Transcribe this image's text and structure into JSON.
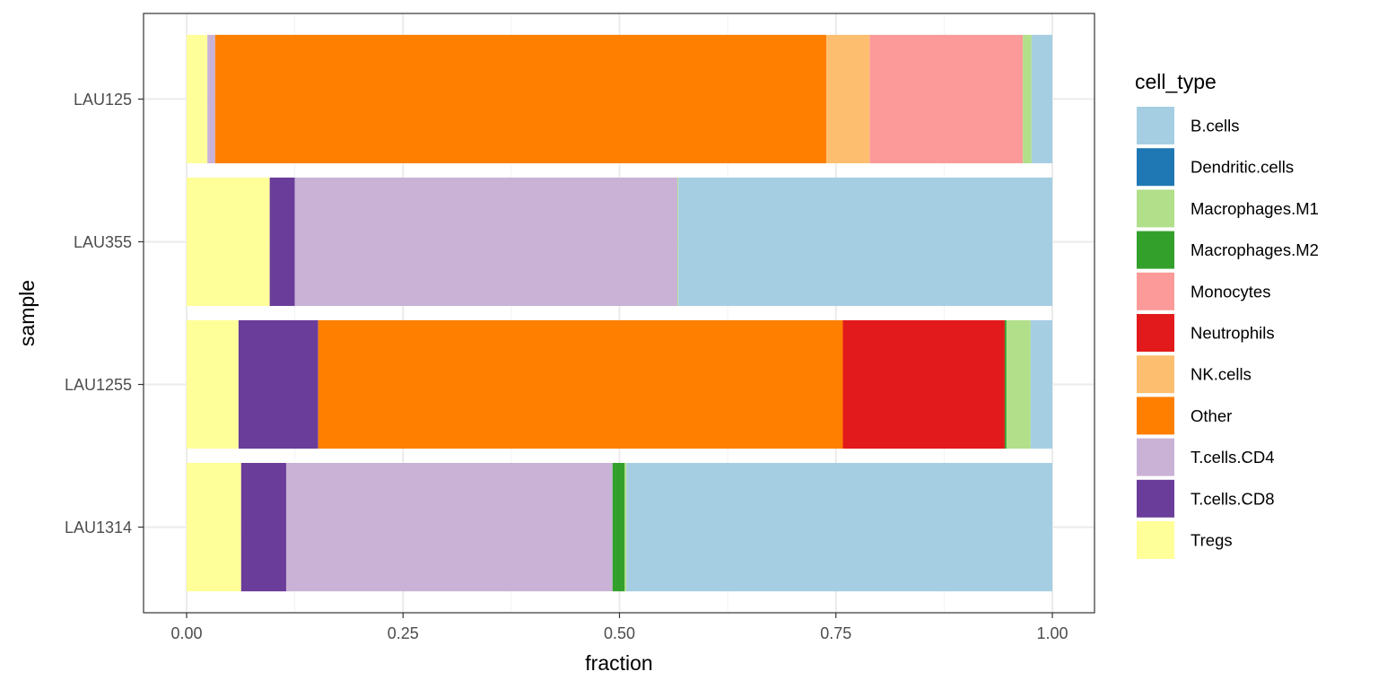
{
  "chart_data": {
    "type": "bar",
    "orientation": "horizontal",
    "stacked": true,
    "title": "",
    "xlabel": "fraction",
    "ylabel": "sample",
    "xlim": [
      0,
      1
    ],
    "x_ticks": [
      0,
      0.25,
      0.5,
      0.75,
      1.0
    ],
    "x_tick_labels": [
      "0.00",
      "0.25",
      "0.50",
      "0.75",
      "1.00"
    ],
    "categories": [
      "LAU125",
      "LAU355",
      "LAU1255",
      "LAU1314"
    ],
    "grid": true,
    "legend": {
      "title": "cell_type",
      "position": "right"
    },
    "series": [
      {
        "name": "B.cells",
        "color": "#A6CEE3",
        "values": [
          0.024,
          0.432,
          0.025,
          0.492
        ]
      },
      {
        "name": "Dendritic.cells",
        "color": "#1F78B4",
        "values": [
          0.0,
          0.0,
          0.0,
          0.0
        ]
      },
      {
        "name": "Macrophages.M1",
        "color": "#B2DF8A",
        "values": [
          0.01,
          0.001,
          0.028,
          0.002
        ]
      },
      {
        "name": "Macrophages.M2",
        "color": "#33A02C",
        "values": [
          0.0,
          0.0,
          0.002,
          0.014
        ]
      },
      {
        "name": "Monocytes",
        "color": "#FB9A99",
        "values": [
          0.177,
          0.0,
          0.0,
          0.0
        ]
      },
      {
        "name": "Neutrophils",
        "color": "#E31A1C",
        "values": [
          0.0,
          0.0,
          0.187,
          0.0
        ]
      },
      {
        "name": "NK.cells",
        "color": "#FDBF6F",
        "values": [
          0.05,
          0.0,
          0.0,
          0.0
        ]
      },
      {
        "name": "Other",
        "color": "#FF7F00",
        "values": [
          0.706,
          0.0,
          0.606,
          0.0
        ]
      },
      {
        "name": "T.cells.CD4",
        "color": "#CAB2D6",
        "values": [
          0.009,
          0.442,
          0.0,
          0.377
        ]
      },
      {
        "name": "T.cells.CD8",
        "color": "#6A3D9A",
        "values": [
          0.0,
          0.029,
          0.092,
          0.052
        ]
      },
      {
        "name": "Tregs",
        "color": "#FFFF99",
        "values": [
          0.024,
          0.096,
          0.06,
          0.063
        ]
      }
    ]
  }
}
